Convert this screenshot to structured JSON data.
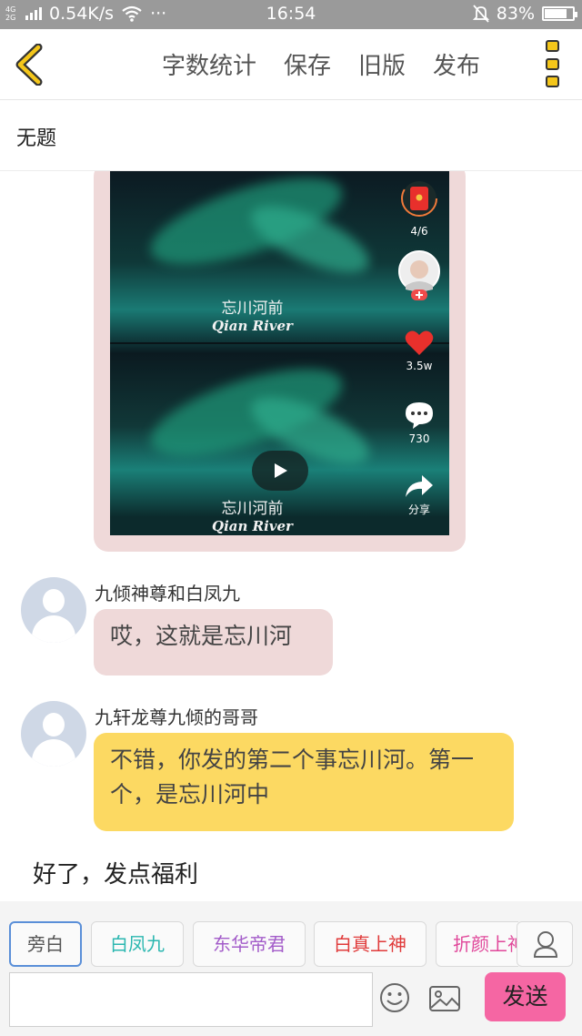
{
  "status_bar": {
    "network_type": "4G 2G",
    "speed": "0.54K/s",
    "more": "···",
    "time": "16:54",
    "battery": "83%",
    "battery_level": 0.83
  },
  "toolbar": {
    "back_icon": "chevron-left-icon",
    "word_count": "字数统计",
    "save": "保存",
    "old_version": "旧版",
    "publish": "发布",
    "menu_icon": "more-vertical-icon",
    "accent_color": "#f4c61a"
  },
  "document": {
    "title": "无题"
  },
  "media": {
    "caption_cn": "忘川河前",
    "caption_en": "Qian River",
    "caption_cn_2": "忘川河前",
    "caption_en_2": "Qian River",
    "redpacket_count": "4/6",
    "likes": "3.5w",
    "comments": "730",
    "share": "分享",
    "card_color": "#efd9d9"
  },
  "messages": [
    {
      "sender": "九倾神尊和白凤九",
      "text": "哎，这就是忘川河",
      "bubble_color": "#efd9d9"
    },
    {
      "sender": "九轩龙尊九倾的哥哥",
      "text": "不错，你发的第二个事忘川河。第一个，是忘川河中",
      "bubble_color": "#fcd962"
    }
  ],
  "narration": "好了，发点福利",
  "roles": [
    {
      "label": "旁白",
      "color": "#555555"
    },
    {
      "label": "白凤九",
      "color": "#2bb7b0"
    },
    {
      "label": "东华帝君",
      "color": "#a35cc9"
    },
    {
      "label": "白真上神",
      "color": "#e03a3a"
    },
    {
      "label": "折颜上神",
      "color": "#e0479a"
    }
  ],
  "input": {
    "placeholder": "",
    "send_label": "发送",
    "send_color": "#f566a3"
  }
}
